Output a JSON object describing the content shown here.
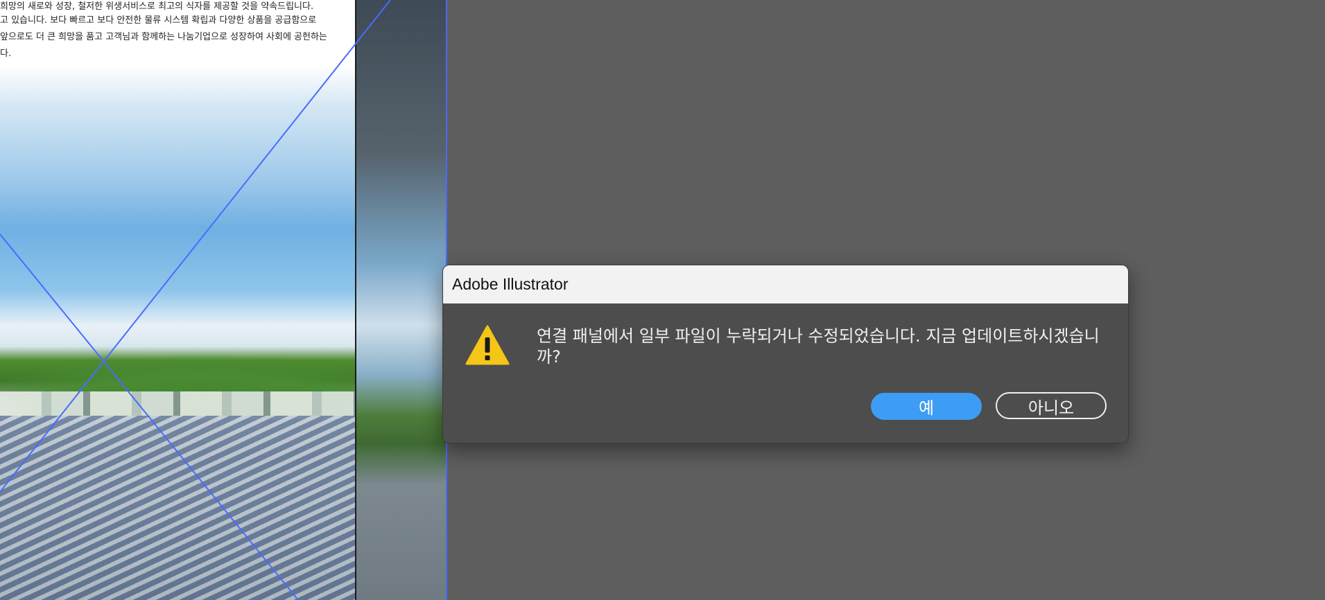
{
  "artboard": {
    "paragraph_lines": [
      "희망의 새로와 성장, 철저한 위생서비스로 최고의 식자를 제공할 것을 약속드립니다.",
      "고 있습니다. 보다 빠르고 보다 안전한 물류 시스템 확립과 다양한 상품을 공급함으로",
      "앞으로도 더 큰 희망을 품고 고객님과 함께하는 나눔기업으로 성장하여 사회에 공헌하는",
      "다."
    ]
  },
  "dialog": {
    "title": "Adobe Illustrator",
    "icon": "warning-icon",
    "message": "연결 패널에서 일부 파일이 누락되거나 수정되었습니다. 지금 업데이트하시겠습니까?",
    "buttons": {
      "yes_label": "예",
      "no_label": "아니오"
    }
  },
  "colors": {
    "pasteboard": "#5e5e5e",
    "dialog_body": "#4d4d4d",
    "dialog_titlebar": "#f2f2f2",
    "primary_button": "#3d9df5",
    "guide_line": "#4a6bff",
    "warning": "#f5c518"
  }
}
